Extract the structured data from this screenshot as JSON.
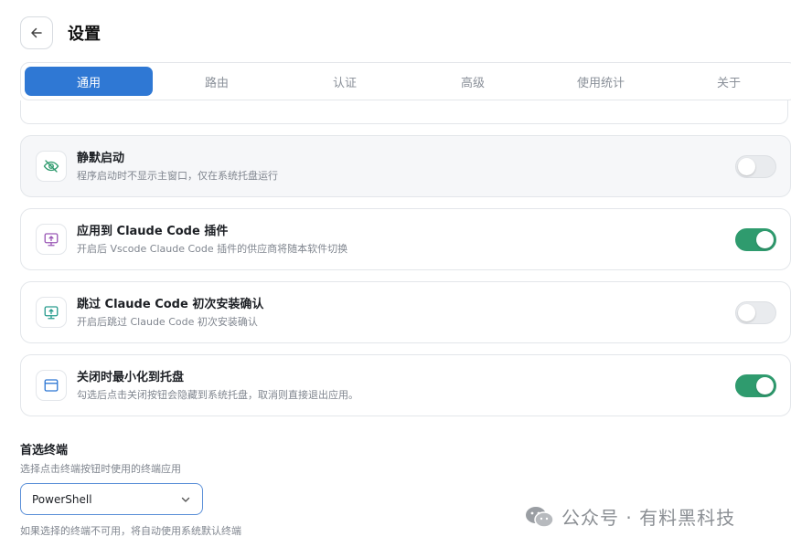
{
  "header": {
    "title": "设置"
  },
  "tabs": [
    {
      "label": "通用",
      "active": true
    },
    {
      "label": "路由",
      "active": false
    },
    {
      "label": "认证",
      "active": false
    },
    {
      "label": "高级",
      "active": false
    },
    {
      "label": "使用统计",
      "active": false
    },
    {
      "label": "关于",
      "active": false
    }
  ],
  "settings": [
    {
      "icon": "eye-off-icon",
      "title": "静默启动",
      "desc": "程序启动时不显示主窗口，仅在系统托盘运行",
      "enabled": false
    },
    {
      "icon": "monitor-upload-icon",
      "title": "应用到 Claude Code 插件",
      "desc": "开启后 Vscode Claude Code 插件的供应商将随本软件切换",
      "enabled": true
    },
    {
      "icon": "monitor-upload-icon",
      "title": "跳过 Claude Code 初次安装确认",
      "desc": "开启后跳过 Claude Code 初次安装确认",
      "enabled": false
    },
    {
      "icon": "window-icon",
      "title": "关闭时最小化到托盘",
      "desc": "勾选后点击关闭按钮会隐藏到系统托盘，取消则直接退出应用。",
      "enabled": true
    }
  ],
  "terminal": {
    "title": "首选终端",
    "desc": "选择点击终端按钮时使用的终端应用",
    "selected": "PowerShell",
    "hint": "如果选择的终端不可用，将自动使用系统默认终端"
  },
  "watermark": {
    "text": "公众号 · 有料黑科技"
  },
  "colors": {
    "accent": "#2f78d4",
    "toggle_on": "#2f9b6e",
    "icon_green": "#2f9b6e",
    "icon_purple": "#9b59b6",
    "icon_teal": "#2a9d8f",
    "icon_blue": "#2f78d4"
  }
}
